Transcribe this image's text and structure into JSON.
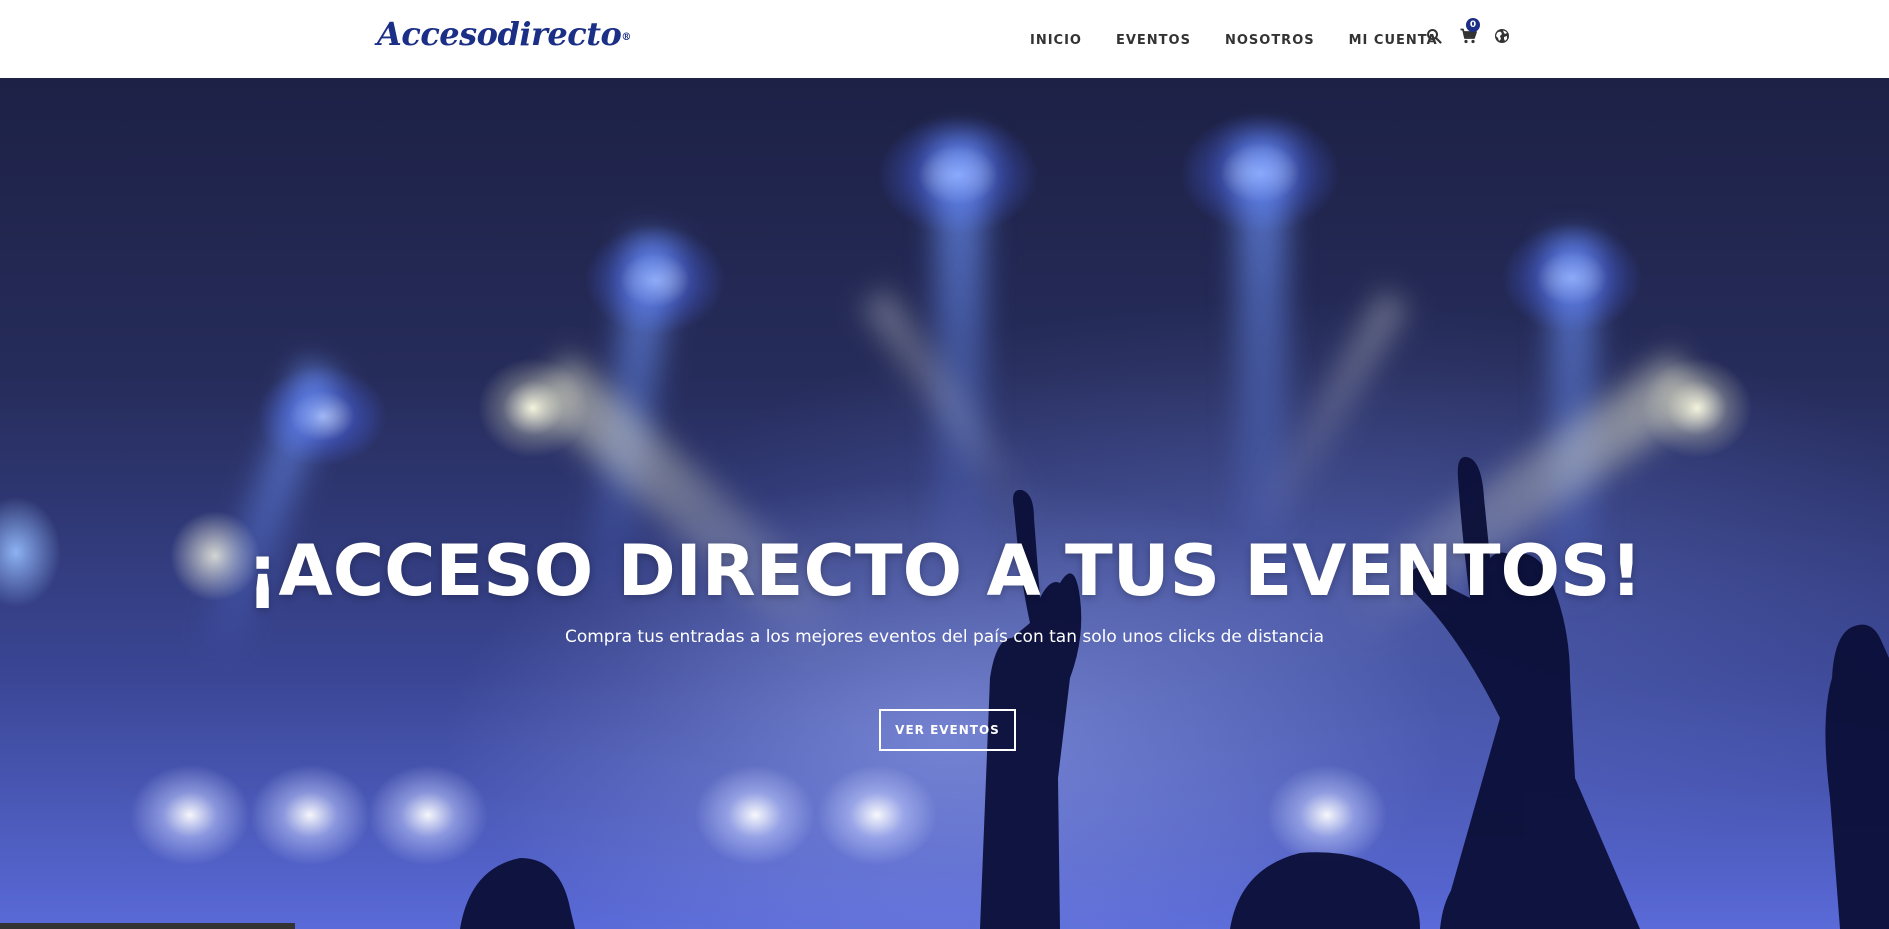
{
  "header": {
    "logo_text": "Accesodirecto",
    "logo_mark": "®",
    "brand_color": "#1c2f86",
    "nav": [
      {
        "label": "INICIO"
      },
      {
        "label": "EVENTOS"
      },
      {
        "label": "NOSOTROS"
      },
      {
        "label": "MI CUENTA"
      }
    ],
    "icons": [
      "search-icon",
      "cart-icon",
      "globe-icon"
    ],
    "cart_count": "0"
  },
  "hero": {
    "title": "¡ACCESO DIRECTO A TUS EVENTOS!",
    "subtitle": "Compra tus entradas a los mejores eventos del país con tan solo unos clicks de distancia",
    "button_label": "VER EVENTOS"
  }
}
